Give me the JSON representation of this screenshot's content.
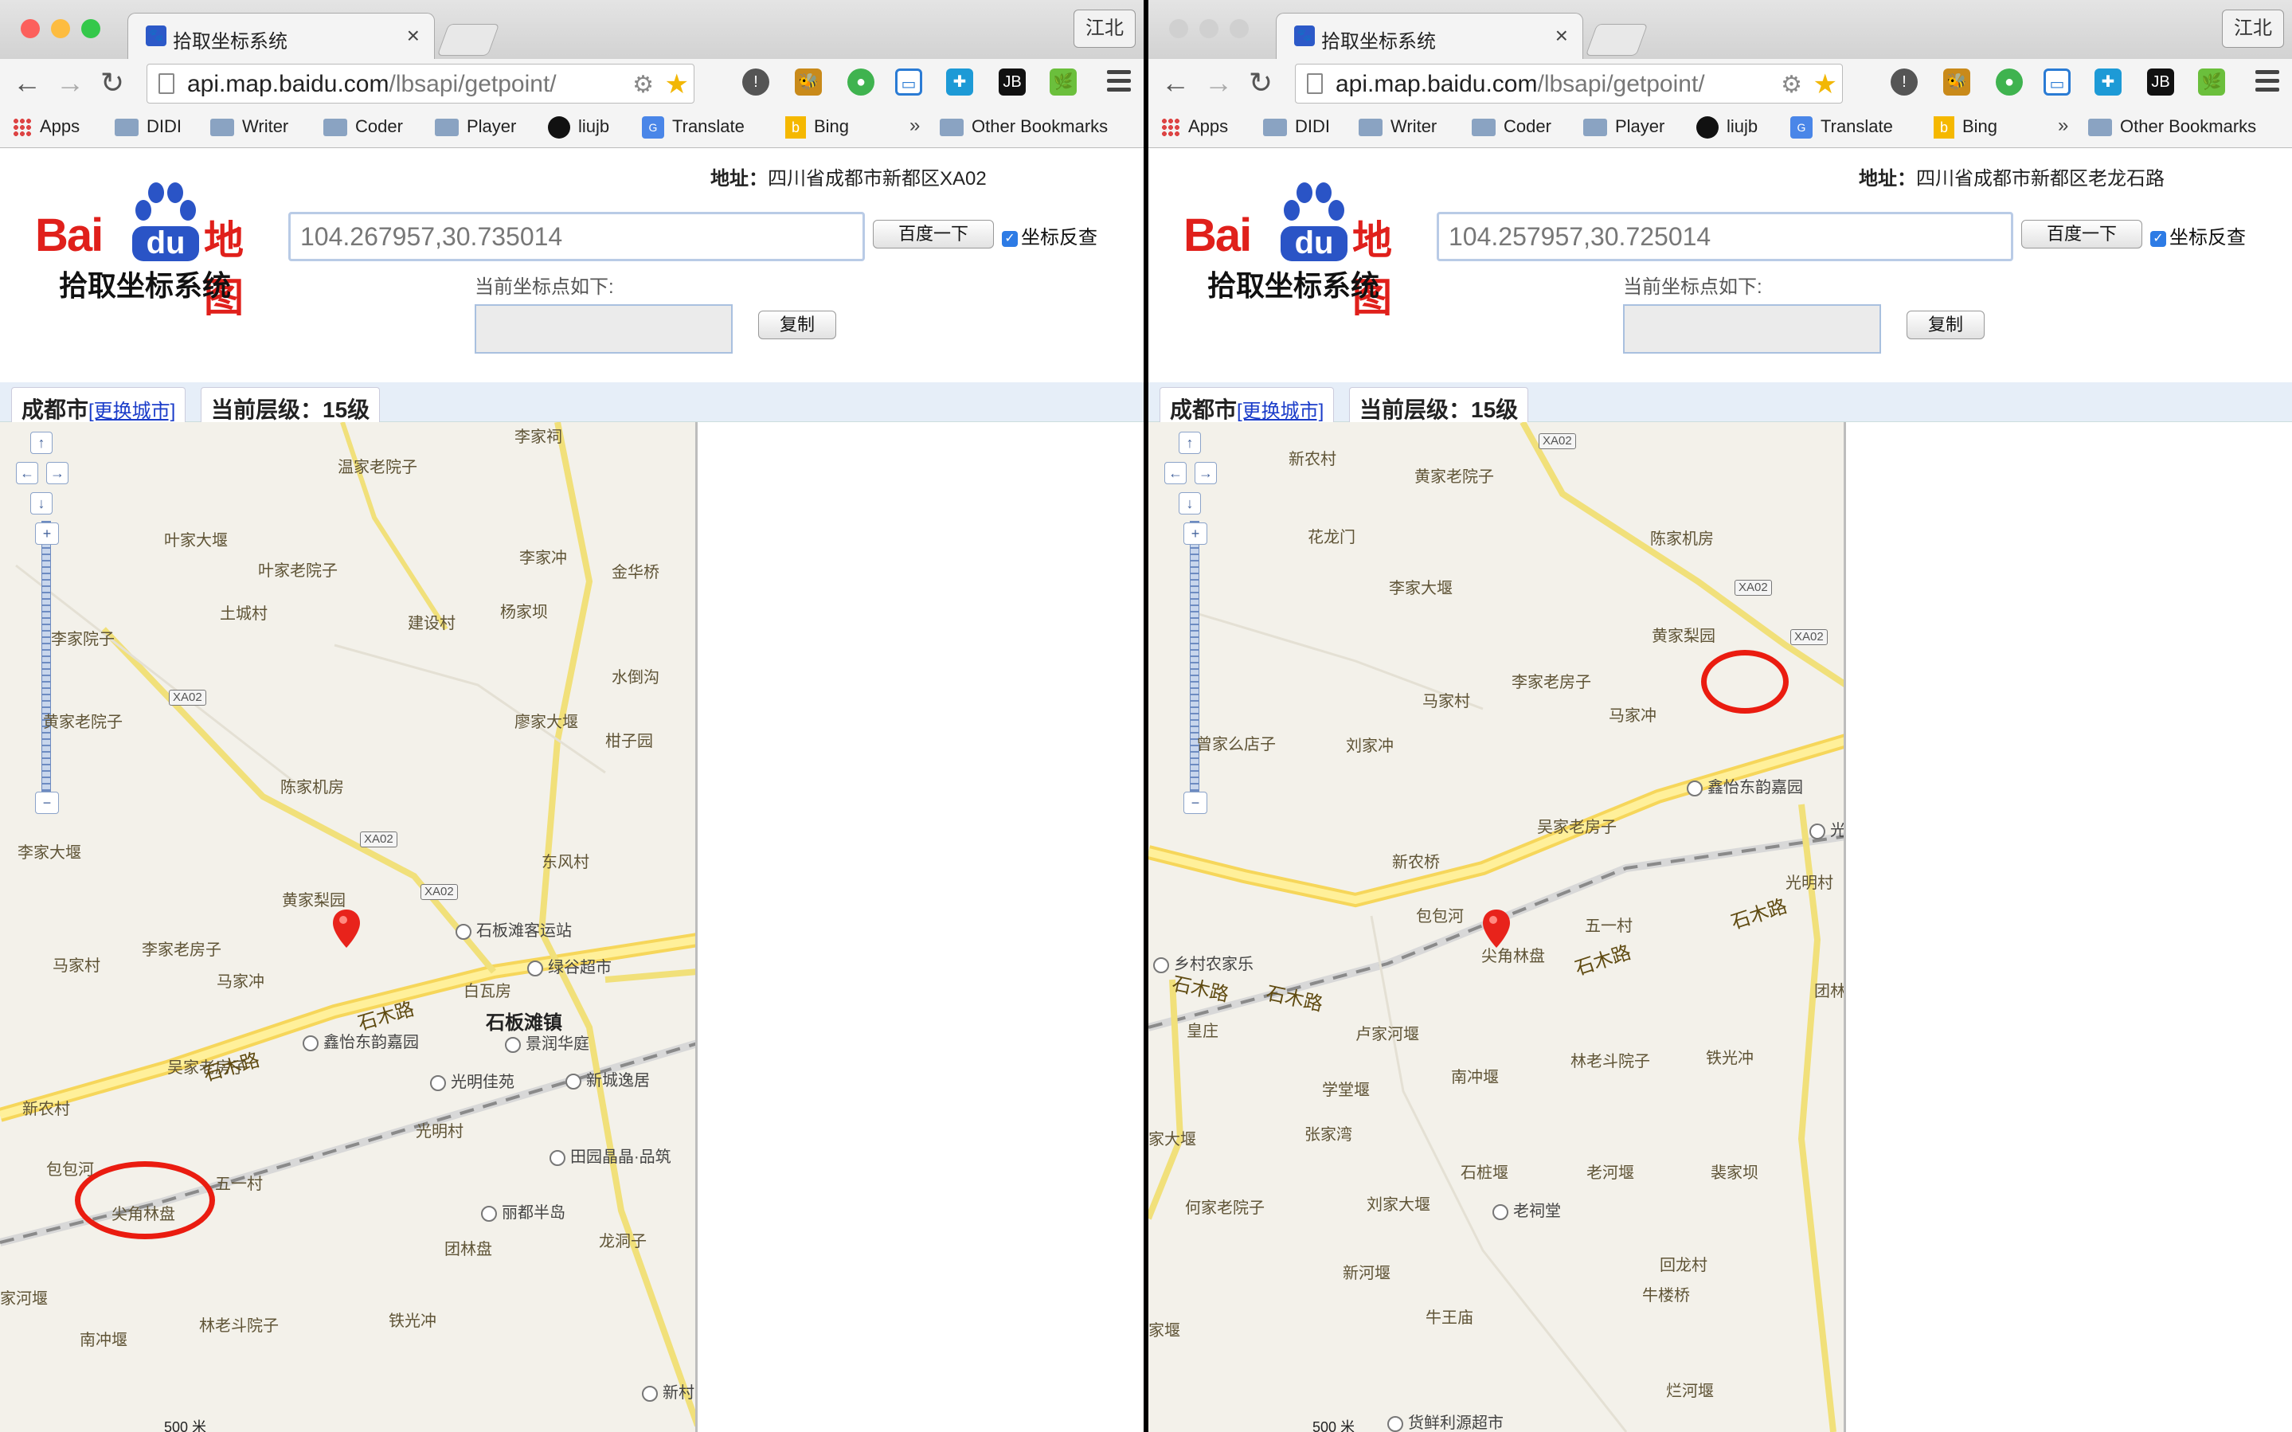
{
  "browser": {
    "tab_title": "拾取坐标系统",
    "user_label": "江北",
    "url_host": "api.map.baidu.com",
    "url_path": "/lbsapi/getpoint/",
    "bookmarks": [
      "Apps",
      "DIDI",
      "Writer",
      "Coder",
      "Player",
      "liujb",
      "Translate",
      "Bing"
    ],
    "overflow_label": "»",
    "other_bookmarks": "Other Bookmarks"
  },
  "header": {
    "logo_brand": "Bai",
    "logo_du": "du",
    "logo_map": "地图",
    "logo_sub": "拾取坐标系统",
    "search_button": "百度一下",
    "reverse_label": "坐标反查",
    "current_point_label": "当前坐标点如下:",
    "copy_button": "复制"
  },
  "city": {
    "name": "成都市",
    "change_link": "[更换城市]",
    "zoom_level": "当前层级：15级"
  },
  "address_prefix": "地址：",
  "scale_label": "500 米",
  "left": {
    "coordinates": "104.267957,30.735014",
    "address": "四川省成都市新都区XA02",
    "road_labels": [
      "石木路",
      "石木路"
    ],
    "route_shields": [
      "XA02",
      "XA02",
      "XA02"
    ],
    "place_labels": [
      "李家祠",
      "温家老院子",
      "叶家大堰",
      "叶家老院子",
      "李家冲",
      "金华桥",
      "土城村",
      "建设村",
      "杨家坝",
      "水倒沟",
      "李家院子",
      "黄家老院子",
      "廖家大堰",
      "柑子园",
      "陈家机房",
      "李家大堰",
      "东风村",
      "黄家梨园",
      "李家老房子",
      "马家村",
      "马家冲",
      "白瓦房",
      "吴家老房子",
      "新农村",
      "光明村",
      "包包河",
      "五一村",
      "尖角林盘",
      "团林盘",
      "龙洞子",
      "家河堰",
      "南冲堰",
      "林老斗院子",
      "铁光冲"
    ],
    "town_label": "石板滩镇",
    "pois": [
      "石板滩客运站",
      "绿谷超市",
      "景润华庭",
      "鑫怡东韵嘉园",
      "光明佳苑",
      "新城逸居",
      "田园晶晶·品筑",
      "丽都半岛",
      "新村"
    ]
  },
  "right": {
    "coordinates": "104.257957,30.725014",
    "address": "四川省成都市新都区老龙石路",
    "road_labels": [
      "石木路",
      "石木路",
      "石木路",
      "石木路"
    ],
    "route_shields": [
      "XA02",
      "XA02",
      "XA02"
    ],
    "place_labels": [
      "新农村",
      "黄家老院子",
      "花龙门",
      "陈家机房",
      "李家大堰",
      "黄家梨园",
      "李家老房子",
      "马家村",
      "马家冲",
      "曾家么店子",
      "刘家冲",
      "吴家老房子",
      "新农桥",
      "包包河",
      "五一村",
      "尖角林盘",
      "光明村",
      "团林",
      "皇庄",
      "卢家河堰",
      "南冲堰",
      "林老斗院子",
      "铁光冲",
      "学堂堰",
      "张家湾",
      "家大堰",
      "石桩堰",
      "老河堰",
      "裴家坝",
      "何家老院子",
      "刘家大堰",
      "新河堰",
      "回龙村",
      "牛楼桥",
      "牛王庙",
      "烂河堰",
      "家堰"
    ],
    "pois": [
      "鑫怡东韵嘉园",
      "光",
      "乡村农家乐",
      "老祠堂",
      "货鲜利源超市"
    ]
  }
}
